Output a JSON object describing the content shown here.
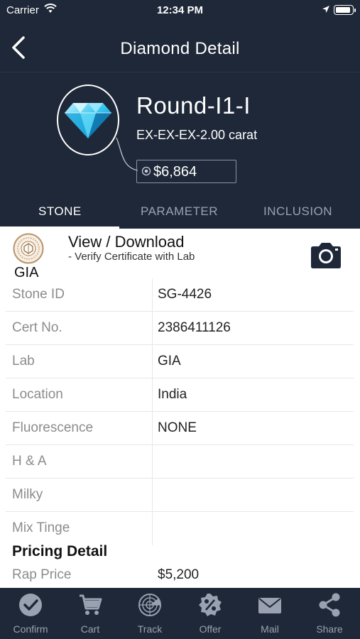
{
  "status_bar": {
    "carrier": "Carrier",
    "time": "12:34 PM"
  },
  "nav": {
    "title": "Diamond Detail"
  },
  "stone": {
    "shape_title": "Round-I1-I",
    "spec": "EX-EX-EX-2.00 carat",
    "price": "$6,864"
  },
  "tabs": [
    {
      "label": "STONE",
      "active": true
    },
    {
      "label": "PARAMETER",
      "active": false
    },
    {
      "label": "INCLUSION",
      "active": false
    }
  ],
  "certificate": {
    "lab": "GIA",
    "view_label": "View / Download",
    "verify_label": "- Verify Certificate with Lab"
  },
  "details": [
    {
      "key": "Stone ID",
      "value": "SG-4426"
    },
    {
      "key": "Cert No.",
      "value": "2386411126"
    },
    {
      "key": "Lab",
      "value": "GIA"
    },
    {
      "key": "Location",
      "value": "India"
    },
    {
      "key": "Fluorescence",
      "value": "NONE"
    },
    {
      "key": "H & A",
      "value": ""
    },
    {
      "key": "Milky",
      "value": ""
    },
    {
      "key": "Mix Tinge",
      "value": ""
    }
  ],
  "pricing": {
    "title": "Pricing Detail",
    "rap_price_label": "Rap Price",
    "rap_price_value": "$5,200"
  },
  "bottom_tabs": [
    {
      "label": "Confirm",
      "icon": "check-circle-icon"
    },
    {
      "label": "Cart",
      "icon": "cart-icon"
    },
    {
      "label": "Track",
      "icon": "radar-icon"
    },
    {
      "label": "Offer",
      "icon": "percent-badge-icon"
    },
    {
      "label": "Mail",
      "icon": "mail-icon"
    },
    {
      "label": "Share",
      "icon": "share-icon"
    }
  ],
  "colors": {
    "header_bg": "#1f2838",
    "tab_inactive": "#9aa2b2"
  }
}
